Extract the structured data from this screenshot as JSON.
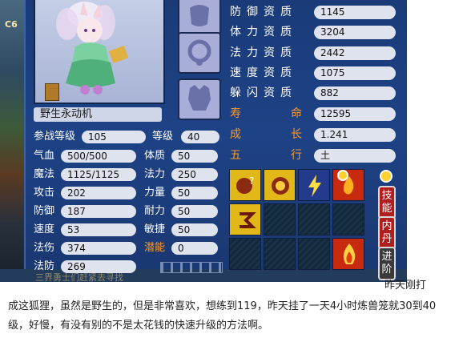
{
  "scene": {
    "tag": "C6",
    "scroll_text": "三界勇士们赶紧去寻找"
  },
  "pet": {
    "name": "野生永动机"
  },
  "stats_left": [
    {
      "label": "参战等级",
      "value": "105"
    },
    {
      "label": "气血",
      "value": "500/500"
    },
    {
      "label": "魔法",
      "value": "1125/1125"
    },
    {
      "label": "攻击",
      "value": "202"
    },
    {
      "label": "防御",
      "value": "187"
    },
    {
      "label": "速度",
      "value": "53"
    },
    {
      "label": "法伤",
      "value": "374"
    },
    {
      "label": "法防",
      "value": "269"
    }
  ],
  "stats_right": [
    {
      "label": "等级",
      "value": "40"
    },
    {
      "label": "体质",
      "value": "50"
    },
    {
      "label": "法力",
      "value": "250"
    },
    {
      "label": "力量",
      "value": "50"
    },
    {
      "label": "耐力",
      "value": "50"
    },
    {
      "label": "敏捷",
      "value": "50"
    },
    {
      "label": "潜能",
      "value": "0"
    }
  ],
  "qualities": [
    {
      "label": "防御资质",
      "value": "1145"
    },
    {
      "label": "体力资质",
      "value": "3204"
    },
    {
      "label": "法力资质",
      "value": "2442"
    },
    {
      "label": "速度资质",
      "value": "1075"
    },
    {
      "label": "躲闪资质",
      "value": "882"
    }
  ],
  "attributes": [
    {
      "label_a": "寿",
      "label_b": "命",
      "value": "12595"
    },
    {
      "label_a": "成",
      "label_b": "长",
      "value": "1.241"
    },
    {
      "label_a": "五",
      "label_b": "行",
      "value": "土"
    }
  ],
  "side_buttons": {
    "skills": "技能",
    "neidan": "内丹",
    "advance": "进阶"
  },
  "colors": {
    "panel": "#1e4286",
    "highlight": "#ff9a20",
    "potential": "#ff9a20"
  },
  "caption": {
    "line1_tail": "昨天刚打",
    "line2": "成这狐狸，虽然是野生的，但是非常喜欢，想练到119，昨天挂了一天4小时炼兽笼就30到40",
    "line3": "级，好慢，有没有别的不是太花钱的快速升级的方法啊。"
  }
}
